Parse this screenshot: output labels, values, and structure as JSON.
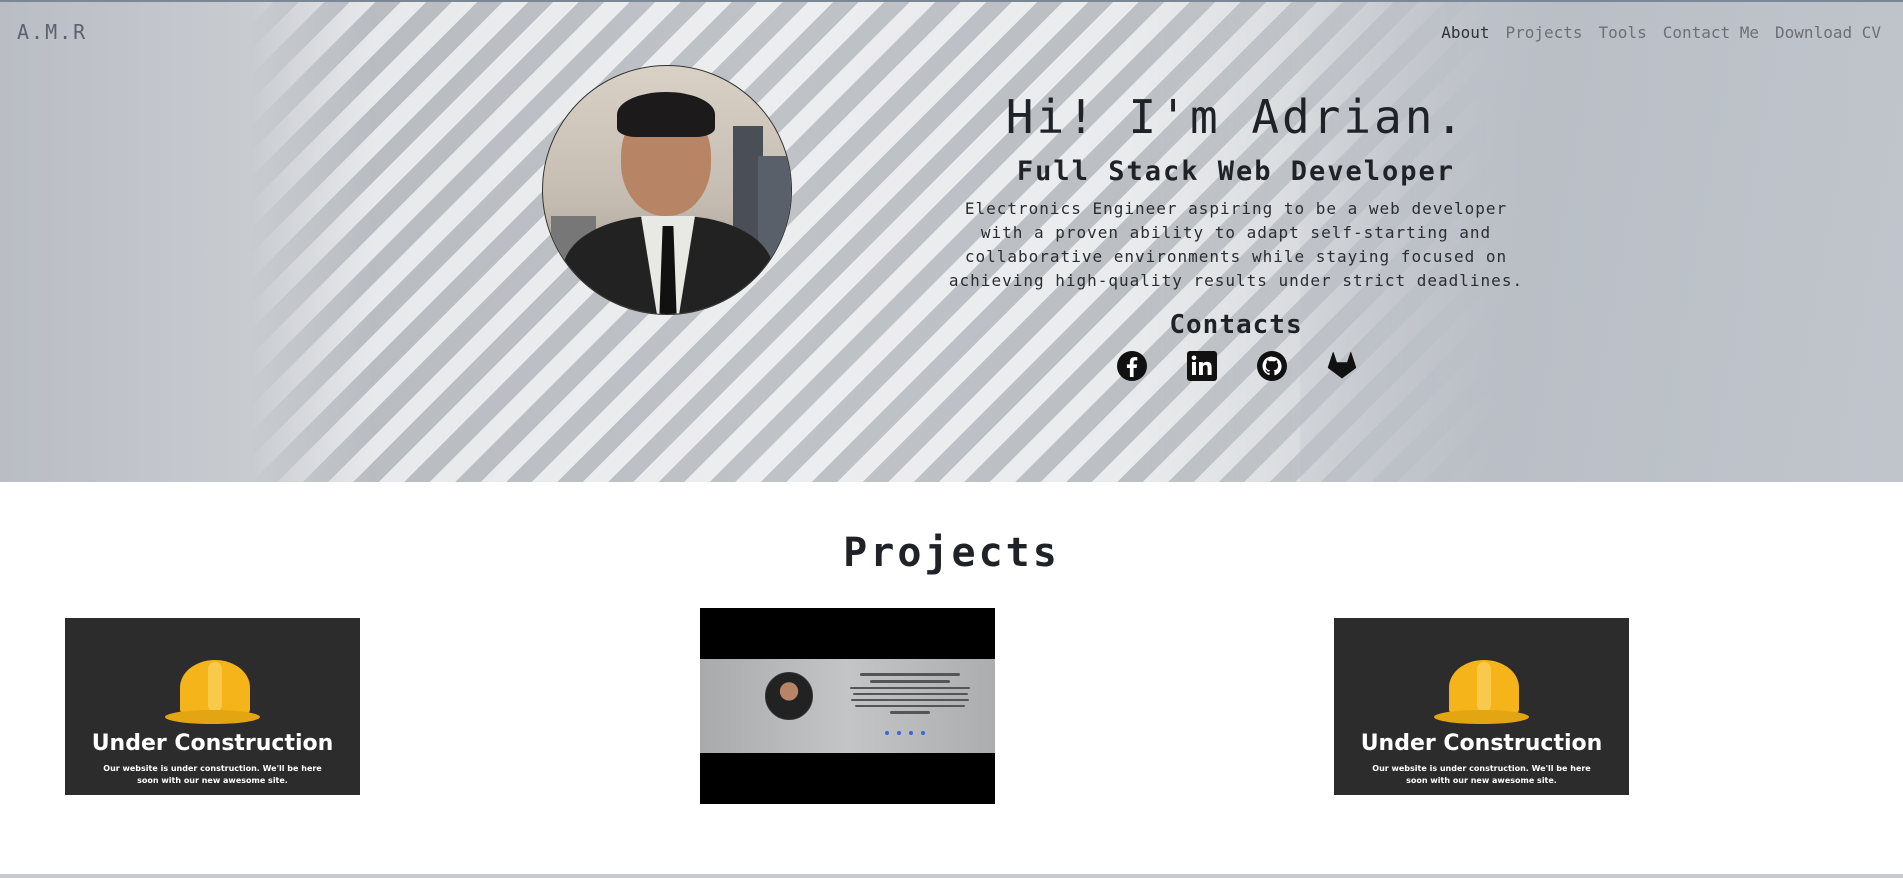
{
  "brand": {
    "logo": "A.M.R"
  },
  "nav": {
    "items": [
      {
        "label": "About",
        "active": true
      },
      {
        "label": "Projects",
        "active": false
      },
      {
        "label": "Tools",
        "active": false
      },
      {
        "label": "Contact Me",
        "active": false
      },
      {
        "label": "Download CV",
        "active": false
      }
    ]
  },
  "hero": {
    "greeting": "Hi! I'm Adrian.",
    "title": "Full Stack Web Developer",
    "summary": "Electronics Engineer aspiring to be a web developer with a proven ability to adapt self-starting and collaborative environments while staying focused on achieving high-quality results under strict deadlines.",
    "contacts_label": "Contacts",
    "social_icons": [
      "facebook-icon",
      "linkedin-icon",
      "github-icon",
      "gitlab-icon"
    ]
  },
  "projects": {
    "title": "Projects",
    "cards": [
      {
        "kind": "under-construction",
        "heading": "Under Construction",
        "text": "Our website is under construction. We'll be here soon with our new awesome site."
      },
      {
        "kind": "portfolio-screenshot"
      },
      {
        "kind": "under-construction",
        "heading": "Under Construction",
        "text": "Our website is under construction. We'll be here soon with our new awesome site."
      }
    ]
  },
  "colors": {
    "text_dark": "#1f2328",
    "nav_inactive": "#6d6f74",
    "card_bg": "#2c2c2c",
    "helmet": "#f4b41a"
  }
}
